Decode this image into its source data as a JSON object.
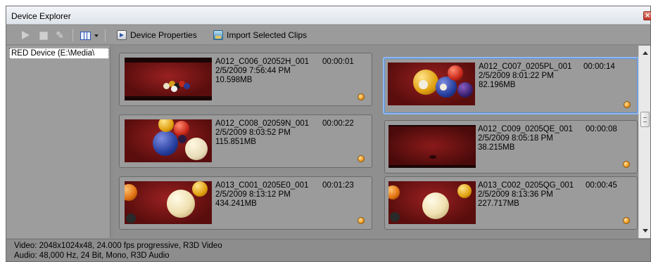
{
  "window": {
    "title": "Device Explorer",
    "close_glyph": "✕"
  },
  "toolbar": {
    "play_icon": "play-icon",
    "stop_icon": "stop-icon",
    "pin_icon": "pin-icon",
    "view_icon": "grid-view-icon",
    "device_properties_label": "Device Properties",
    "import_label": "Import Selected Clips"
  },
  "sidebar": {
    "device_label": "RED Device (E:\\Media\\"
  },
  "clips": [
    {
      "name": "A012_C006_02052H_001",
      "duration": "00:00:01",
      "date": "2/5/2009 7:56:44 PM",
      "size": "10.598MB",
      "selected": false
    },
    {
      "name": "A012_C007_0205PL_001",
      "duration": "00:00:14",
      "date": "2/5/2009 8:01:22 PM",
      "size": "82.196MB",
      "selected": true
    },
    {
      "name": "A012_C008_02059N_001",
      "duration": "00:00:22",
      "date": "2/5/2009 8:03:52 PM",
      "size": "115.851MB",
      "selected": false
    },
    {
      "name": "A012_C009_0205QE_001",
      "duration": "00:00:08",
      "date": "2/5/2009 8:05:18 PM",
      "size": "38.215MB",
      "selected": false
    },
    {
      "name": "A013_C001_0205E0_001",
      "duration": "00:01:23",
      "date": "2/5/2009 8:13:12 PM",
      "size": "434.241MB",
      "selected": false
    },
    {
      "name": "A013_C002_0205QG_001",
      "duration": "00:00:45",
      "date": "2/5/2009 8:13:36 PM",
      "size": "227.717MB",
      "selected": false
    }
  ],
  "status": {
    "video": "Video: 2048x1024x48, 24.000 fps progressive, R3D Video",
    "audio": "Audio: 48,000 Hz, 24 Bit, Mono, R3D Audio"
  },
  "colors": {
    "selection_border": "#8fb8ee",
    "status_dot": "#f09a20",
    "felt": "#9a2121"
  }
}
